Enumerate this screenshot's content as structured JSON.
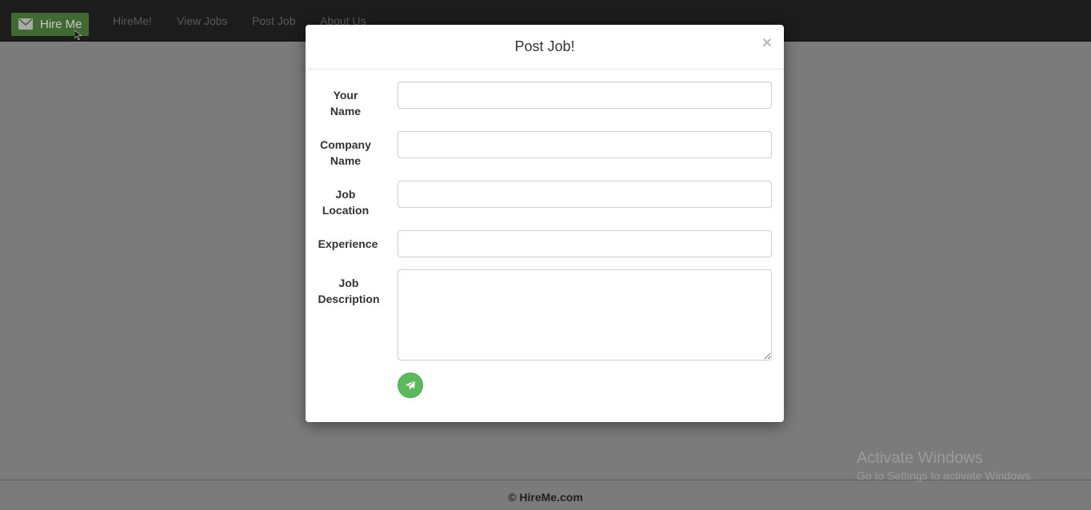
{
  "navbar": {
    "brand_label": "Hire Me",
    "brand_icon": "envelope-icon",
    "links": [
      "HireMe!",
      "View Jobs",
      "Post Job",
      "About Us"
    ]
  },
  "modal": {
    "title": "Post Job!",
    "close_label": "×",
    "fields": [
      {
        "label_line1": "Your",
        "label_line2": "Name",
        "value": "",
        "type": "text"
      },
      {
        "label_line1": "Company",
        "label_line2": "Name",
        "value": "",
        "type": "text"
      },
      {
        "label_line1": "Job",
        "label_line2": "Location",
        "value": "",
        "type": "text"
      },
      {
        "label_line1": "Experience",
        "label_line2": "",
        "value": "",
        "type": "text"
      },
      {
        "label_line1": "Job",
        "label_line2": "Description",
        "value": "",
        "type": "textarea"
      }
    ],
    "submit_icon": "send-icon"
  },
  "footer": {
    "copyright": "© HireMe.com"
  },
  "watermark": {
    "line1": "Activate Windows",
    "line2": "Go to Settings to activate Windows."
  },
  "colors": {
    "navbar_bg": "#1c1c1c",
    "brand_bg": "#3f6b32",
    "backdrop": "#7b7b7b",
    "submit_green": "#5cb85c"
  }
}
